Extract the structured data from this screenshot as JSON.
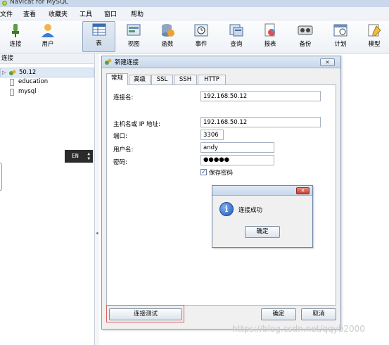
{
  "window": {
    "title": "Navicat for MySQL"
  },
  "menu": [
    "文件",
    "查看",
    "收藏夹",
    "工具",
    "窗口",
    "帮助"
  ],
  "toolbar": [
    "连接",
    "用户",
    "表",
    "视图",
    "函数",
    "事件",
    "查询",
    "报表",
    "备份",
    "计划",
    "模型"
  ],
  "left_panel": {
    "header": "连接",
    "connection": "50.12",
    "databases": [
      "education",
      "mysql"
    ]
  },
  "ime_indicator": "EN",
  "dialog": {
    "title": "新建连接",
    "close_label": "✕",
    "tabs": [
      "常规",
      "高级",
      "SSL",
      "SSH",
      "HTTP"
    ],
    "fields": {
      "connection_name_label": "连接名:",
      "connection_name_value": "192.168.50.12",
      "host_label": "主机名或 IP 地址:",
      "host_value": "192.168.50.12",
      "port_label": "端口:",
      "port_value": "3306",
      "username_label": "用户名:",
      "username_value": "andy",
      "password_label": "密码:",
      "password_value": "●●●●●",
      "save_password_label": "保存密码",
      "save_password_checked": true
    },
    "buttons": {
      "test_connection": "连接测试",
      "ok": "确定",
      "cancel": "取消"
    }
  },
  "message_box": {
    "close_label": "✕",
    "message": "连接成功",
    "ok": "确定"
  },
  "watermark": "https://blog.csdn.net/qqyb2000",
  "colors": {
    "accent": "#8ea6c7",
    "test_highlight": "#e06060"
  }
}
